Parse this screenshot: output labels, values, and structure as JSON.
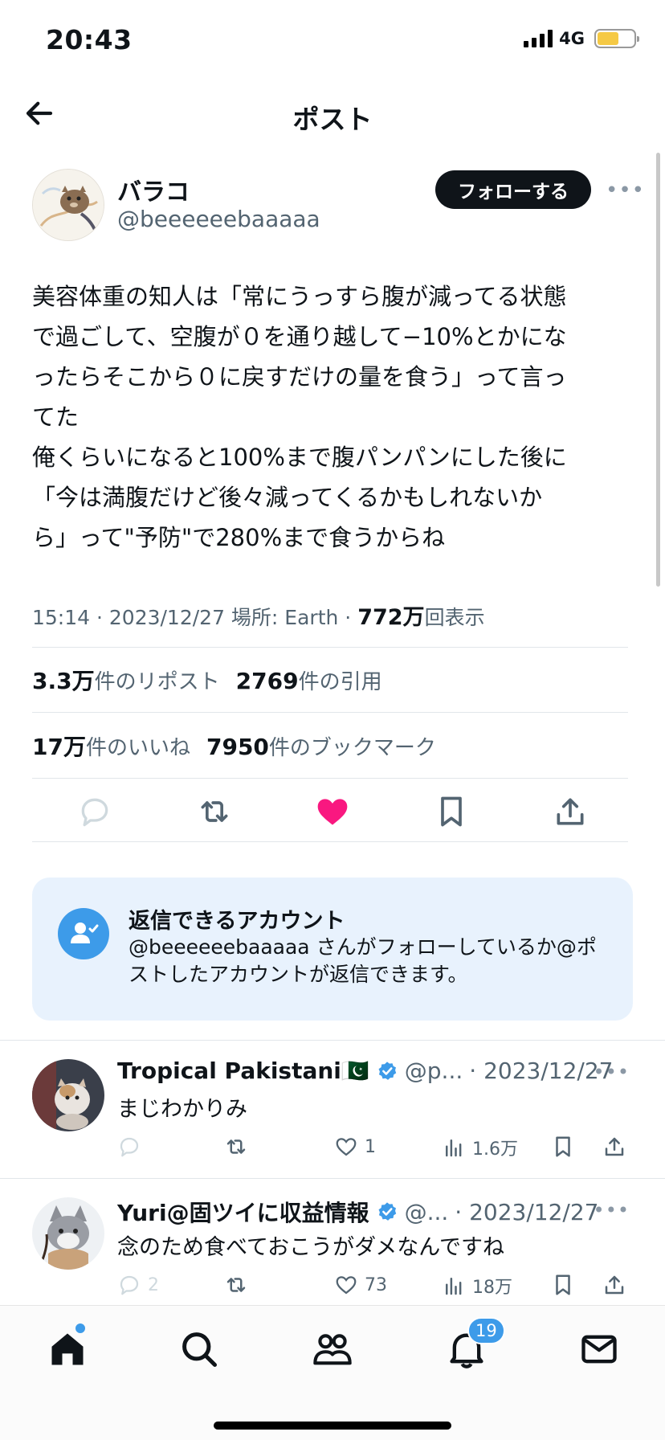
{
  "status_bar": {
    "time": "20:43",
    "network": "4G",
    "battery_level": 0.6
  },
  "header": {
    "title": "ポスト"
  },
  "author": {
    "name": "バラコ",
    "handle": "@beeeeeebaaaaa",
    "follow_label": "フォローする"
  },
  "post": {
    "lines": [
      "美容体重の知人は「常にうっすら腹が減ってる状態",
      "で過ごして、空腹が０を通り越して−10%とかにな",
      "ったらそこから０に戻すだけの量を食う」って言っ",
      "てた",
      "俺くらいになると100%まで腹パンパンにした後に",
      "「今は満腹だけど後々減ってくるかもしれないか",
      "ら」って\"予防\"で280%まで食うからね"
    ],
    "meta_prefix": "15:14 · 2023/12/27 場所: Earth · ",
    "views_value": "772万",
    "views_label": "回表示"
  },
  "stats": {
    "reposts_value": "3.3万",
    "reposts_label": "件のリポスト",
    "quotes_value": "2769",
    "quotes_label": "件の引用",
    "likes_value": "17万",
    "likes_label": "件のいいね",
    "bookmarks_value": "7950",
    "bookmarks_label": "件のブックマーク"
  },
  "reply_restriction": {
    "title": "返信できるアカウント",
    "description": "@beeeeeebaaaaa さんがフォローしているか@ポストしたアカウントが返信できます。"
  },
  "replies": [
    {
      "name": "Tropical Pakistani🇵🇰",
      "handle": "@p...",
      "date": "· 2023/12/27",
      "text": "まじわかりみ",
      "reply_count": "",
      "like_count": "1",
      "view_count": "1.6万"
    },
    {
      "name": "Yuri@固ツイに収益情報",
      "handle": "@...",
      "date": "· 2023/12/27",
      "text": "念のため食べておこうがダメなんですね",
      "reply_count": "2",
      "like_count": "73",
      "view_count": "18万"
    }
  ],
  "tabbar": {
    "notifications_badge": "19"
  },
  "colors": {
    "accent": "#3d9be9",
    "like": "#f91880",
    "card_bg": "#e8f2fd"
  }
}
